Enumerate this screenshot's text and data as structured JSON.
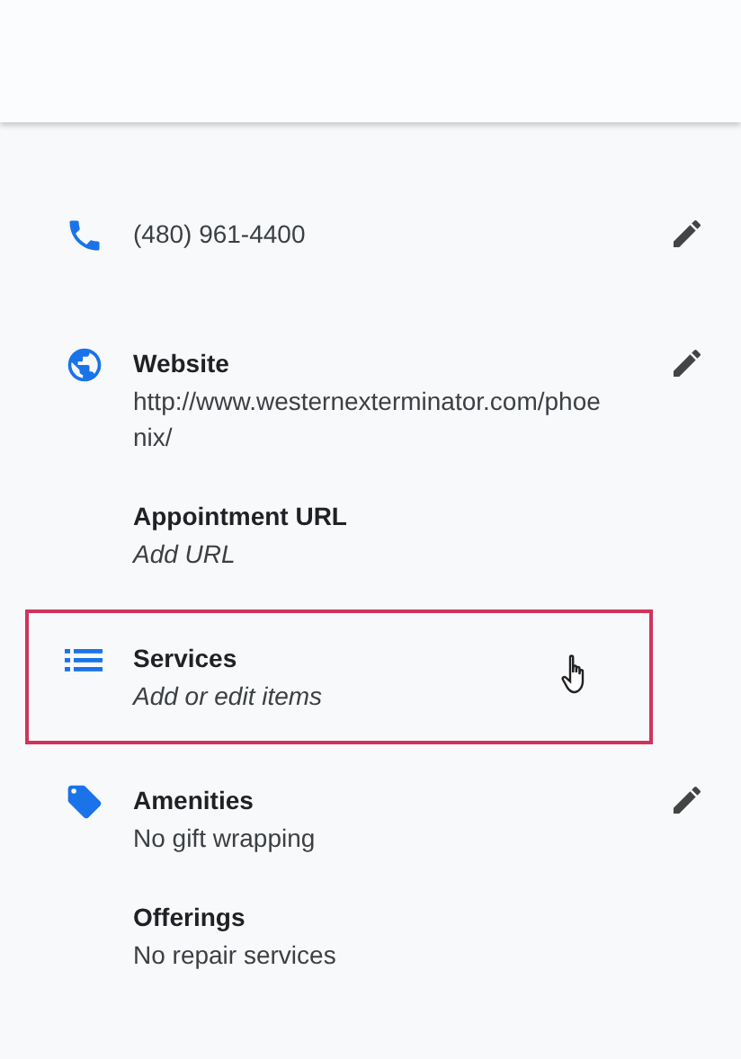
{
  "sections": [
    {
      "kind": "phone",
      "editable": true,
      "highlighted": false,
      "hovered": false,
      "entries": [
        {
          "value": "(480) 961-4400",
          "empty": false
        }
      ]
    },
    {
      "kind": "website",
      "editable": true,
      "highlighted": false,
      "hovered": false,
      "entries": [
        {
          "title": "Website",
          "value": "http://www.westernexterminator.com/phoenix/",
          "empty": false
        },
        {
          "title": "Appointment URL",
          "value": "Add URL",
          "empty": true
        }
      ]
    },
    {
      "kind": "services",
      "editable": false,
      "highlighted": true,
      "hovered": true,
      "entries": [
        {
          "title": "Services",
          "value": "Add or edit items",
          "empty": true
        }
      ]
    },
    {
      "kind": "amenities",
      "editable": true,
      "highlighted": false,
      "hovered": false,
      "entries": [
        {
          "title": "Amenities",
          "value": "No gift wrapping",
          "empty": false
        },
        {
          "title": "Offerings",
          "value": "No repair services",
          "empty": false
        }
      ]
    }
  ]
}
